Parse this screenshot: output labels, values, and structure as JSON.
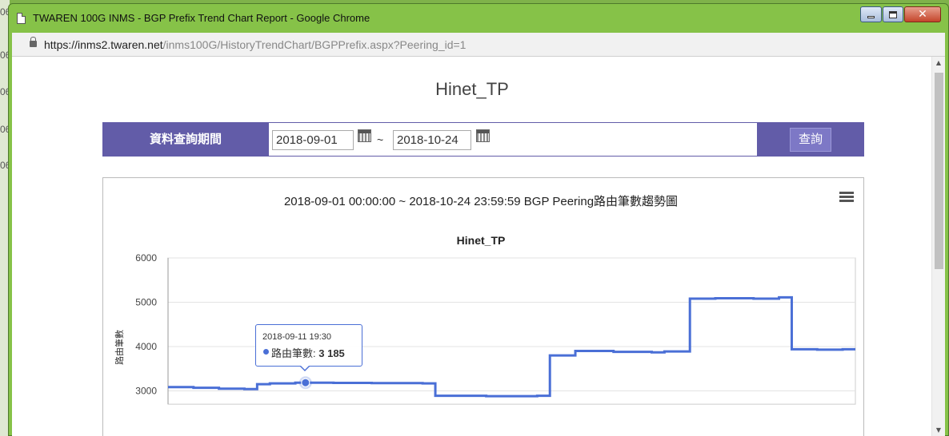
{
  "background_app": {
    "fragments": [
      "06",
      "06",
      "06",
      "06",
      "06"
    ]
  },
  "window": {
    "title": "TWAREN 100G INMS - BGP Prefix Trend Chart Report - Google Chrome",
    "close_glyph": "✕"
  },
  "address": {
    "host": "https://inms2.twaren.net",
    "path": "/inms100G/HistoryTrendChart/BGPPrefix.aspx?Peering_id=1"
  },
  "page": {
    "title": "Hinet_TP"
  },
  "query": {
    "label": "資料查詢期間",
    "start_date": "2018-09-01",
    "end_date": "2018-10-24",
    "separator": "~",
    "button_label": "查詢"
  },
  "chart_data": {
    "type": "line",
    "header": "2018-09-01 00:00:00 ~ 2018-10-24 23:59:59 BGP Peering路由筆數趨勢圖",
    "title": "Hinet_TP",
    "ylabel": "路由筆數",
    "ylim": [
      2700,
      6000
    ],
    "yticks": [
      6000,
      5000,
      4000,
      3000
    ],
    "grid": true,
    "series": [
      {
        "name": "路由筆數",
        "color": "#4a6fd6",
        "x": [
          "2018-09-01",
          "2018-09-03",
          "2018-09-05",
          "2018-09-07",
          "2018-09-08",
          "2018-09-09",
          "2018-09-11",
          "2018-09-14",
          "2018-09-17",
          "2018-09-21",
          "2018-09-22",
          "2018-09-26",
          "2018-09-30",
          "2018-10-01",
          "2018-10-03",
          "2018-10-06",
          "2018-10-09",
          "2018-10-10",
          "2018-10-12",
          "2018-10-14",
          "2018-10-17",
          "2018-10-19",
          "2018-10-20",
          "2018-10-22",
          "2018-10-24"
        ],
        "y": [
          3085,
          3070,
          3050,
          3040,
          3150,
          3170,
          3185,
          3180,
          3175,
          3170,
          2890,
          2880,
          2890,
          3800,
          3900,
          3880,
          3870,
          3890,
          5080,
          5090,
          5080,
          5110,
          3940,
          3930,
          3940
        ]
      }
    ],
    "tooltip": {
      "date": "2018-09-11 19:30",
      "series": "路由筆數",
      "value": "3 185"
    }
  }
}
